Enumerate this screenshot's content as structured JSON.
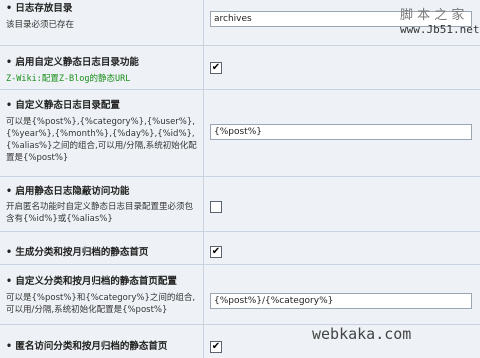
{
  "watermark_top": {
    "text": "脚 本 之 家",
    "url": "www.Jb51.net"
  },
  "watermark_bottom": "webkaka.com",
  "sections": [
    {
      "title": "• 日志存放目录",
      "desc": "该目录必须已存在",
      "value": "archives"
    },
    {
      "title": "• 启用自定义静态日志目录功能",
      "link": "Z-Wiki:配置Z-Blog的静态URL",
      "checked": "✔"
    },
    {
      "title": "• 自定义静态日志目录配置",
      "desc": "可以是{%post%},{%category%},{%user%},{%year%},{%month%},{%day%},{%id%},{%alias%}之间的组合,可以用/分隔,系统初始化配置是{%post%}",
      "value": "{%post%}"
    },
    {
      "title": "• 启用静态日志隐蔽访问功能",
      "desc": "开启匿名功能时自定义静态日志目录配置里必须包含有{%id%}或{%alias%}",
      "checked": ""
    },
    {
      "title": "• 生成分类和按月归档的静态首页",
      "checked": "✔"
    },
    {
      "title": "• 自定义分类和按月归档的静态首页配置",
      "desc": "可以是{%post%}和{%category%}之间的组合,可以用/分隔,系统初始化配置是{%post%}",
      "value": "{%post%}/{%category%}"
    },
    {
      "title": "• 匿名访问分类和按月归档的静态首页",
      "checked": "✔"
    }
  ]
}
